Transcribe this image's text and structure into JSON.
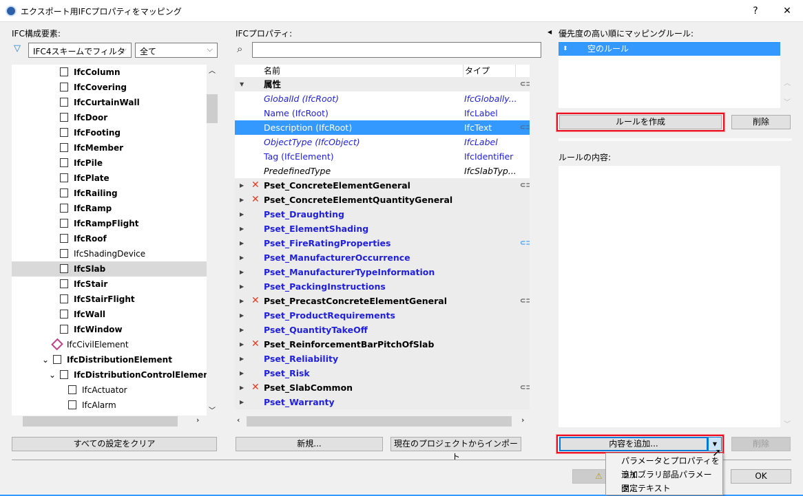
{
  "window": {
    "title": "エクスポート用IFCプロパティをマッピング",
    "help": "?",
    "close": "✕"
  },
  "left": {
    "label": "IFC構成要素:",
    "filter_select": "IFC4スキームでフィルタ",
    "type_select": "全て",
    "clear_button": "すべての設定をクリア",
    "tree": [
      {
        "label": "IfcColumn",
        "bold": true,
        "level": 3
      },
      {
        "label": "IfcCovering",
        "bold": true,
        "level": 3
      },
      {
        "label": "IfcCurtainWall",
        "bold": true,
        "level": 3
      },
      {
        "label": "IfcDoor",
        "bold": true,
        "level": 3
      },
      {
        "label": "IfcFooting",
        "bold": true,
        "level": 3
      },
      {
        "label": "IfcMember",
        "bold": true,
        "level": 3
      },
      {
        "label": "IfcPile",
        "bold": true,
        "level": 3
      },
      {
        "label": "IfcPlate",
        "bold": true,
        "level": 3
      },
      {
        "label": "IfcRailing",
        "bold": true,
        "level": 3
      },
      {
        "label": "IfcRamp",
        "bold": true,
        "level": 3
      },
      {
        "label": "IfcRampFlight",
        "bold": true,
        "level": 3
      },
      {
        "label": "IfcRoof",
        "bold": true,
        "level": 3
      },
      {
        "label": "IfcShadingDevice",
        "bold": false,
        "level": 3
      },
      {
        "label": "IfcSlab",
        "bold": true,
        "level": 3,
        "selected": true
      },
      {
        "label": "IfcStair",
        "bold": true,
        "level": 3
      },
      {
        "label": "IfcStairFlight",
        "bold": true,
        "level": 3
      },
      {
        "label": "IfcWall",
        "bold": true,
        "level": 3
      },
      {
        "label": "IfcWindow",
        "bold": true,
        "level": 3
      },
      {
        "label": "IfcCivilElement",
        "bold": false,
        "level": 2
      },
      {
        "label": "IfcDistributionElement",
        "bold": true,
        "level": 2,
        "expanded": true
      },
      {
        "label": "IfcDistributionControlElement",
        "bold": true,
        "level": 3,
        "expanded": true
      },
      {
        "label": "IfcActuator",
        "bold": false,
        "level": 4
      },
      {
        "label": "IfcAlarm",
        "bold": false,
        "level": 4
      }
    ]
  },
  "middle": {
    "label": "IFCプロパティ:",
    "search_placeholder": "",
    "col_name": "名前",
    "col_type": "タイプ",
    "new_button": "新規...",
    "import_button": "現在のプロジェクトからインポート",
    "rows": [
      {
        "name": "属性",
        "group": true,
        "expanded": true,
        "link": true
      },
      {
        "name": "GlobalId (IfcRoot)",
        "type": "IfcGlobally...",
        "style": "blue it"
      },
      {
        "name": "Name (IfcRoot)",
        "type": "IfcLabel",
        "style": "blue"
      },
      {
        "name": "Description (IfcRoot)",
        "type": "IfcText",
        "style": "blue",
        "selected": true,
        "link": true
      },
      {
        "name": "ObjectType (IfcObject)",
        "type": "IfcLabel",
        "style": "blue it"
      },
      {
        "name": "Tag (IfcElement)",
        "type": "IfcIdentifier",
        "style": "blue"
      },
      {
        "name": "PredefinedType",
        "type": "IfcSlabTyp...",
        "style": "it"
      },
      {
        "name": "Pset_ConcreteElementGeneral",
        "group": true,
        "x": true,
        "link": true
      },
      {
        "name": "Pset_ConcreteElementQuantityGeneral",
        "group": true,
        "x": true
      },
      {
        "name": "Pset_Draughting",
        "group": true,
        "blue": true
      },
      {
        "name": "Pset_ElementShading",
        "group": true,
        "blue": true
      },
      {
        "name": "Pset_FireRatingProperties",
        "group": true,
        "blue": true,
        "link": true
      },
      {
        "name": "Pset_ManufacturerOccurrence",
        "group": true,
        "blue": true
      },
      {
        "name": "Pset_ManufacturerTypeInformation",
        "group": true,
        "blue": true
      },
      {
        "name": "Pset_PackingInstructions",
        "group": true,
        "blue": true
      },
      {
        "name": "Pset_PrecastConcreteElementGeneral",
        "group": true,
        "x": true,
        "link": true
      },
      {
        "name": "Pset_ProductRequirements",
        "group": true,
        "blue": true
      },
      {
        "name": "Pset_QuantityTakeOff",
        "group": true,
        "blue": true
      },
      {
        "name": "Pset_ReinforcementBarPitchOfSlab",
        "group": true,
        "x": true
      },
      {
        "name": "Pset_Reliability",
        "group": true,
        "blue": true
      },
      {
        "name": "Pset_Risk",
        "group": true,
        "blue": true
      },
      {
        "name": "Pset_SlabCommon",
        "group": true,
        "x": true,
        "link": true
      },
      {
        "name": "Pset_Warranty",
        "group": true,
        "blue": true
      }
    ]
  },
  "right": {
    "rules_label": "優先度の高い順にマッピングルール:",
    "rules": [
      {
        "label": "空のルール",
        "selected": true
      }
    ],
    "create_rule_button": "ルールを作成",
    "delete_button": "削除",
    "content_label": "ルールの内容:",
    "add_content_button": "内容を追加...",
    "delete_content_button": "削除"
  },
  "dropdown_menu": {
    "items": [
      "パラメータとプロパティを追加...",
      "ライブラリ部品パラメータ...",
      "固定テキスト"
    ]
  },
  "footer": {
    "ok_button": "OK"
  },
  "colors": {
    "selection": "#3399ff",
    "highlight": "#e81123",
    "link_blue": "#2020dd"
  }
}
